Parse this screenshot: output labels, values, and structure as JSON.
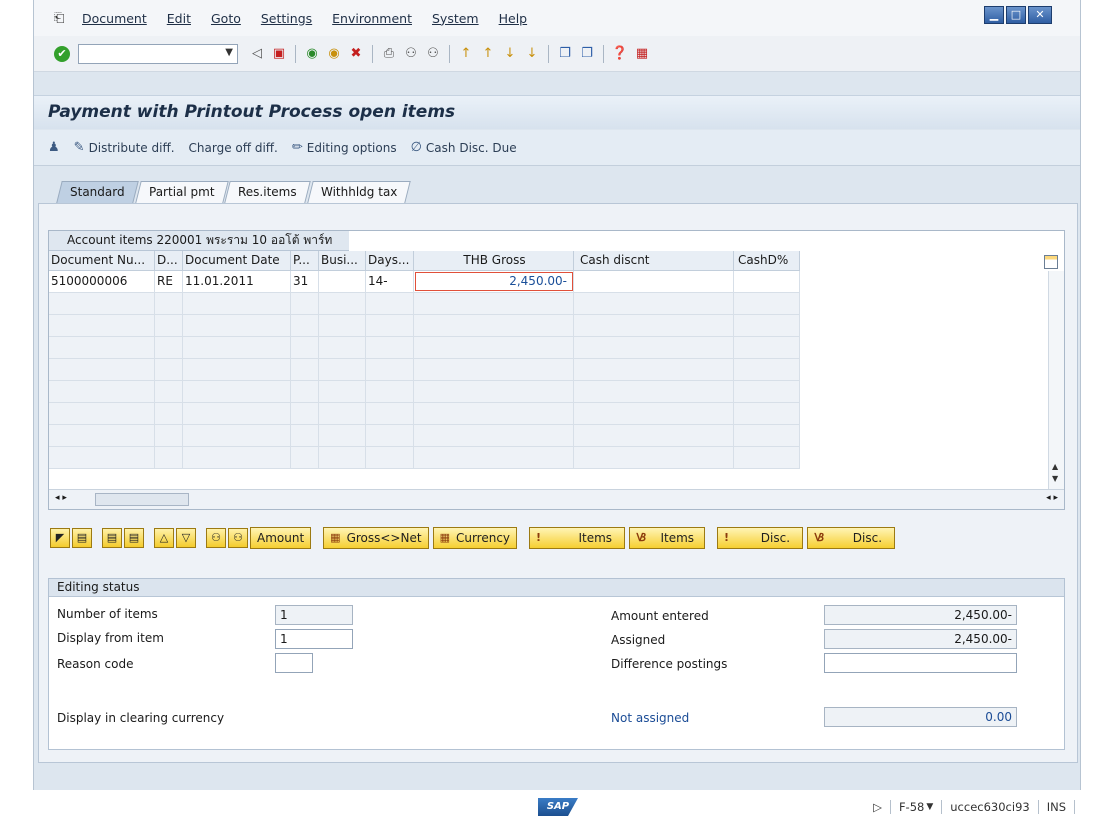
{
  "menubar": {
    "items": [
      "Document",
      "Edit",
      "Goto",
      "Settings",
      "Environment",
      "System",
      "Help"
    ]
  },
  "window_controls": [
    "minimize",
    "maximize",
    "close"
  ],
  "toolbar": {
    "command_field_value": "",
    "icons": [
      "enter-check-icon",
      "back-icon",
      "save-icon",
      "back-green-icon",
      "exit-icon",
      "cancel-icon",
      "print-icon",
      "find-icon",
      "find-next-icon",
      "first-page-icon",
      "prev-page-icon",
      "next-page-icon",
      "last-page-icon",
      "create-session-icon",
      "shortcut-icon",
      "help-icon",
      "layout-icon"
    ]
  },
  "page_title": "Payment with Printout Process open items",
  "app_toolbar": {
    "distribute_label": "Distribute diff.",
    "chargeoff_label": "Charge off diff.",
    "editing_options_label": "Editing options",
    "cash_disc_label": "Cash Disc. Due"
  },
  "tabs": [
    {
      "label": "Standard",
      "active": true
    },
    {
      "label": "Partial pmt",
      "active": false
    },
    {
      "label": "Res.items",
      "active": false
    },
    {
      "label": "Withhldg tax",
      "active": false
    }
  ],
  "grid": {
    "title": "Account items 220001 พระราม 10 ออโต้ พาร์ท",
    "columns": [
      "Document Nu...",
      "D...",
      "Document Date",
      "P...",
      "Busi...",
      "Days...",
      "THB Gross",
      "Cash discnt",
      "CashD%"
    ],
    "rows": [
      [
        "5100000006",
        "RE",
        "11.01.2011",
        "31",
        "",
        "14-",
        "2,450.00-",
        "",
        ""
      ]
    ]
  },
  "buttons": {
    "amount_label": "Amount",
    "gross_net_label": "Gross<>Net",
    "currency_label": "Currency",
    "items_activate_label": "Items",
    "items_deactivate_label": "Items",
    "disc_activate_label": "Disc.",
    "disc_deactivate_label": "Disc."
  },
  "editing_status": {
    "title": "Editing status",
    "number_of_items_label": "Number of items",
    "number_of_items_value": "1",
    "display_from_item_label": "Display from item",
    "display_from_item_value": "1",
    "reason_code_label": "Reason code",
    "reason_code_value": "",
    "display_clearing_label": "Display in clearing currency",
    "amount_entered_label": "Amount entered",
    "amount_entered_value": "2,450.00-",
    "assigned_label": "Assigned",
    "assigned_value": "2,450.00-",
    "difference_postings_label": "Difference postings",
    "difference_postings_value": "",
    "not_assigned_label": "Not assigned",
    "not_assigned_value": "0.00"
  },
  "statusbar": {
    "sap_logo": "SAP",
    "transaction": "F-58",
    "server": "uccec630ci93",
    "mode": "INS"
  }
}
